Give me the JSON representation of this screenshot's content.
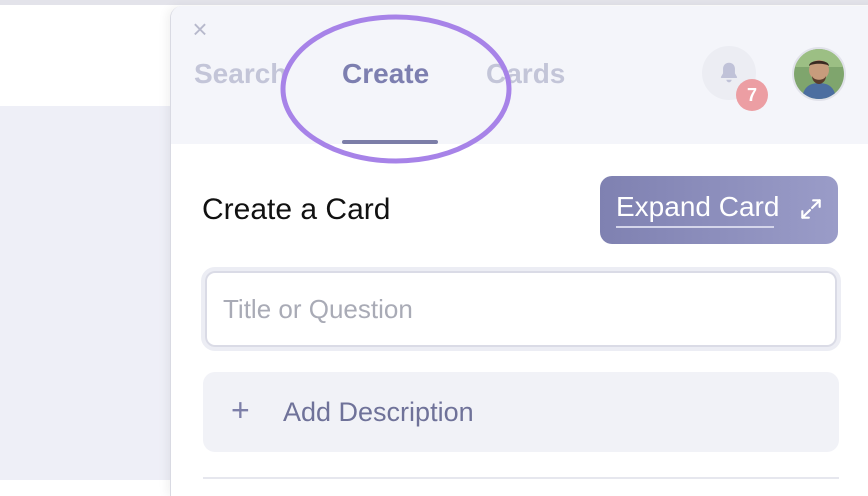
{
  "panel": {
    "close_label": "×",
    "tabs": [
      {
        "label": "Search",
        "active": false
      },
      {
        "label": "Create",
        "active": true
      },
      {
        "label": "Cards",
        "active": false
      }
    ],
    "notifications": {
      "icon": "bell-icon",
      "count": "7"
    },
    "avatar": {
      "icon": "user-avatar"
    }
  },
  "create": {
    "heading": "Create a Card",
    "expand_label": "Expand Card",
    "title_placeholder": "Title or Question",
    "add_description_label": "Add Description",
    "plus_symbol": "+"
  },
  "colors": {
    "accent": "#7d7fb0",
    "highlight": "#a783e8",
    "badge": "#ec9ea3"
  }
}
